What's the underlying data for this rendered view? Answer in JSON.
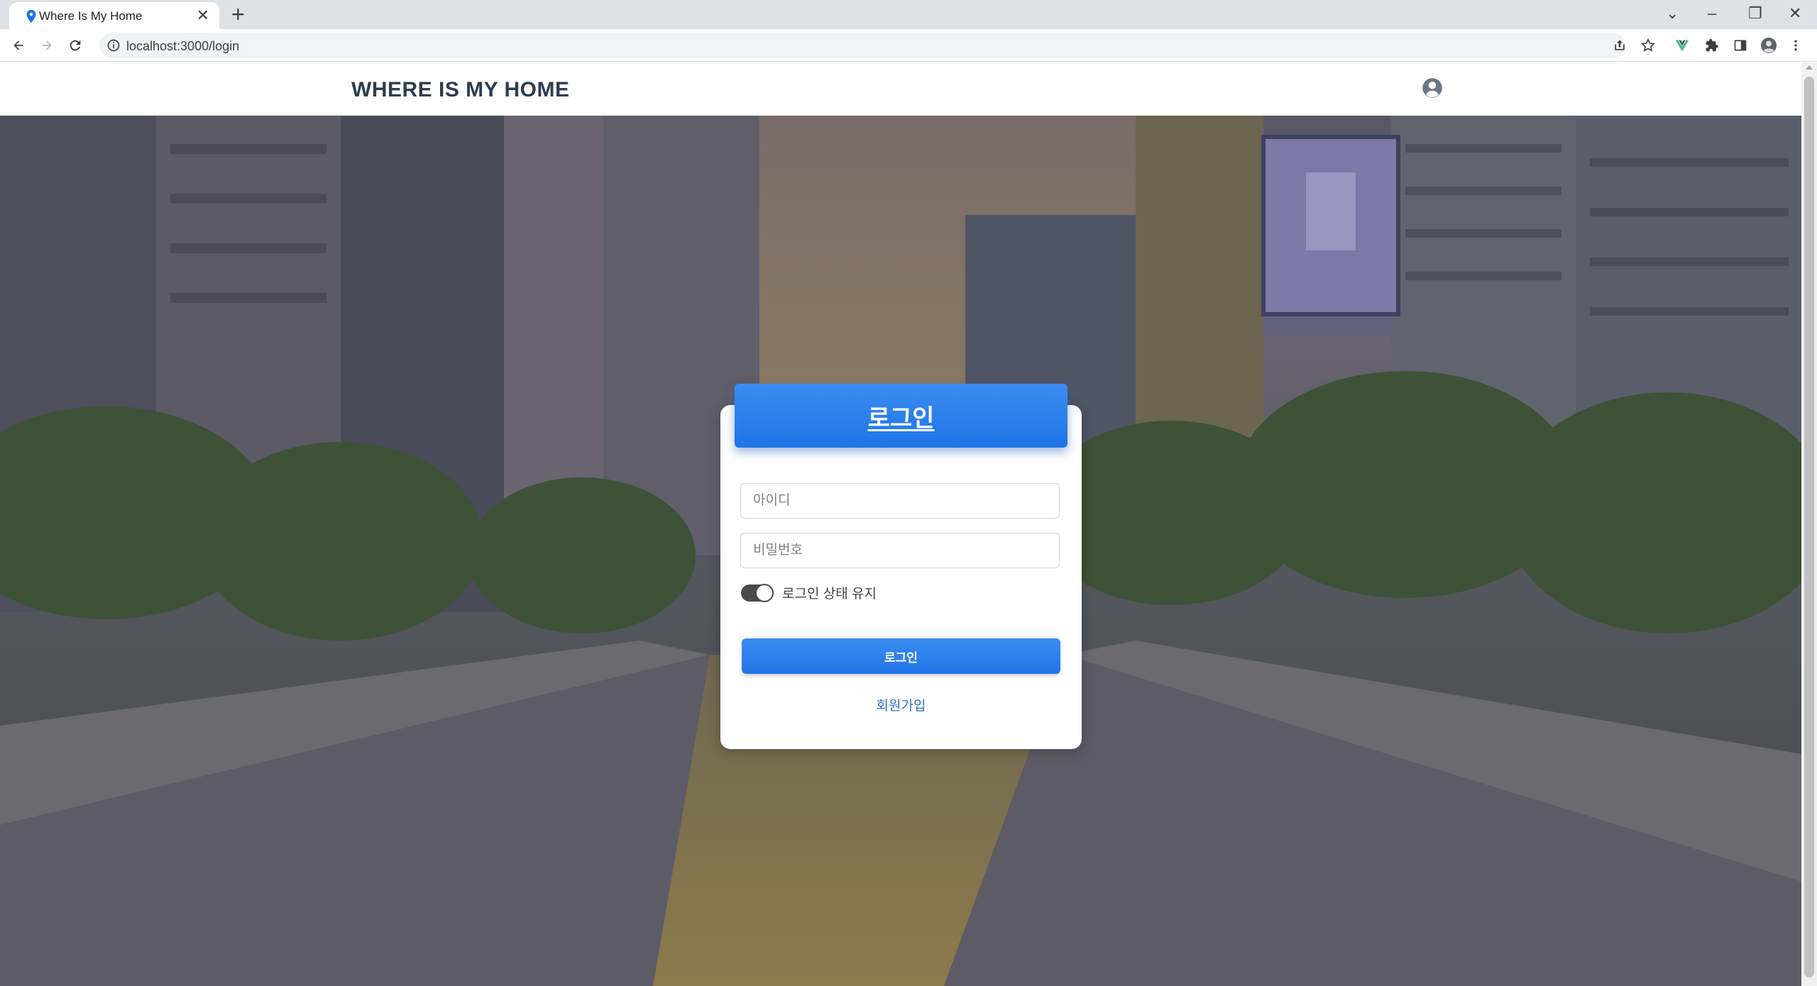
{
  "browser": {
    "tab_title": "Where Is My Home",
    "tab_close": "✕",
    "new_tab": "+",
    "url": "localhost:3000/login",
    "window_controls": {
      "tab_search": "⌄",
      "minimize": "–",
      "restore": "❐",
      "close": "✕"
    }
  },
  "header": {
    "brand": "WHERE IS MY HOME"
  },
  "login": {
    "title": "로그인",
    "id_placeholder": "아이디",
    "password_placeholder": "비밀번호",
    "remember_label": "로그인 상태 유지",
    "remember_on": true,
    "submit_label": "로그인",
    "signup_label": "회원가입"
  },
  "colors": {
    "accent": "#1f74e8",
    "brand_text": "#2c3e50",
    "link": "#2f6fcf"
  },
  "icons": {
    "favicon": "map-pin-icon",
    "user": "user-circle-icon"
  }
}
